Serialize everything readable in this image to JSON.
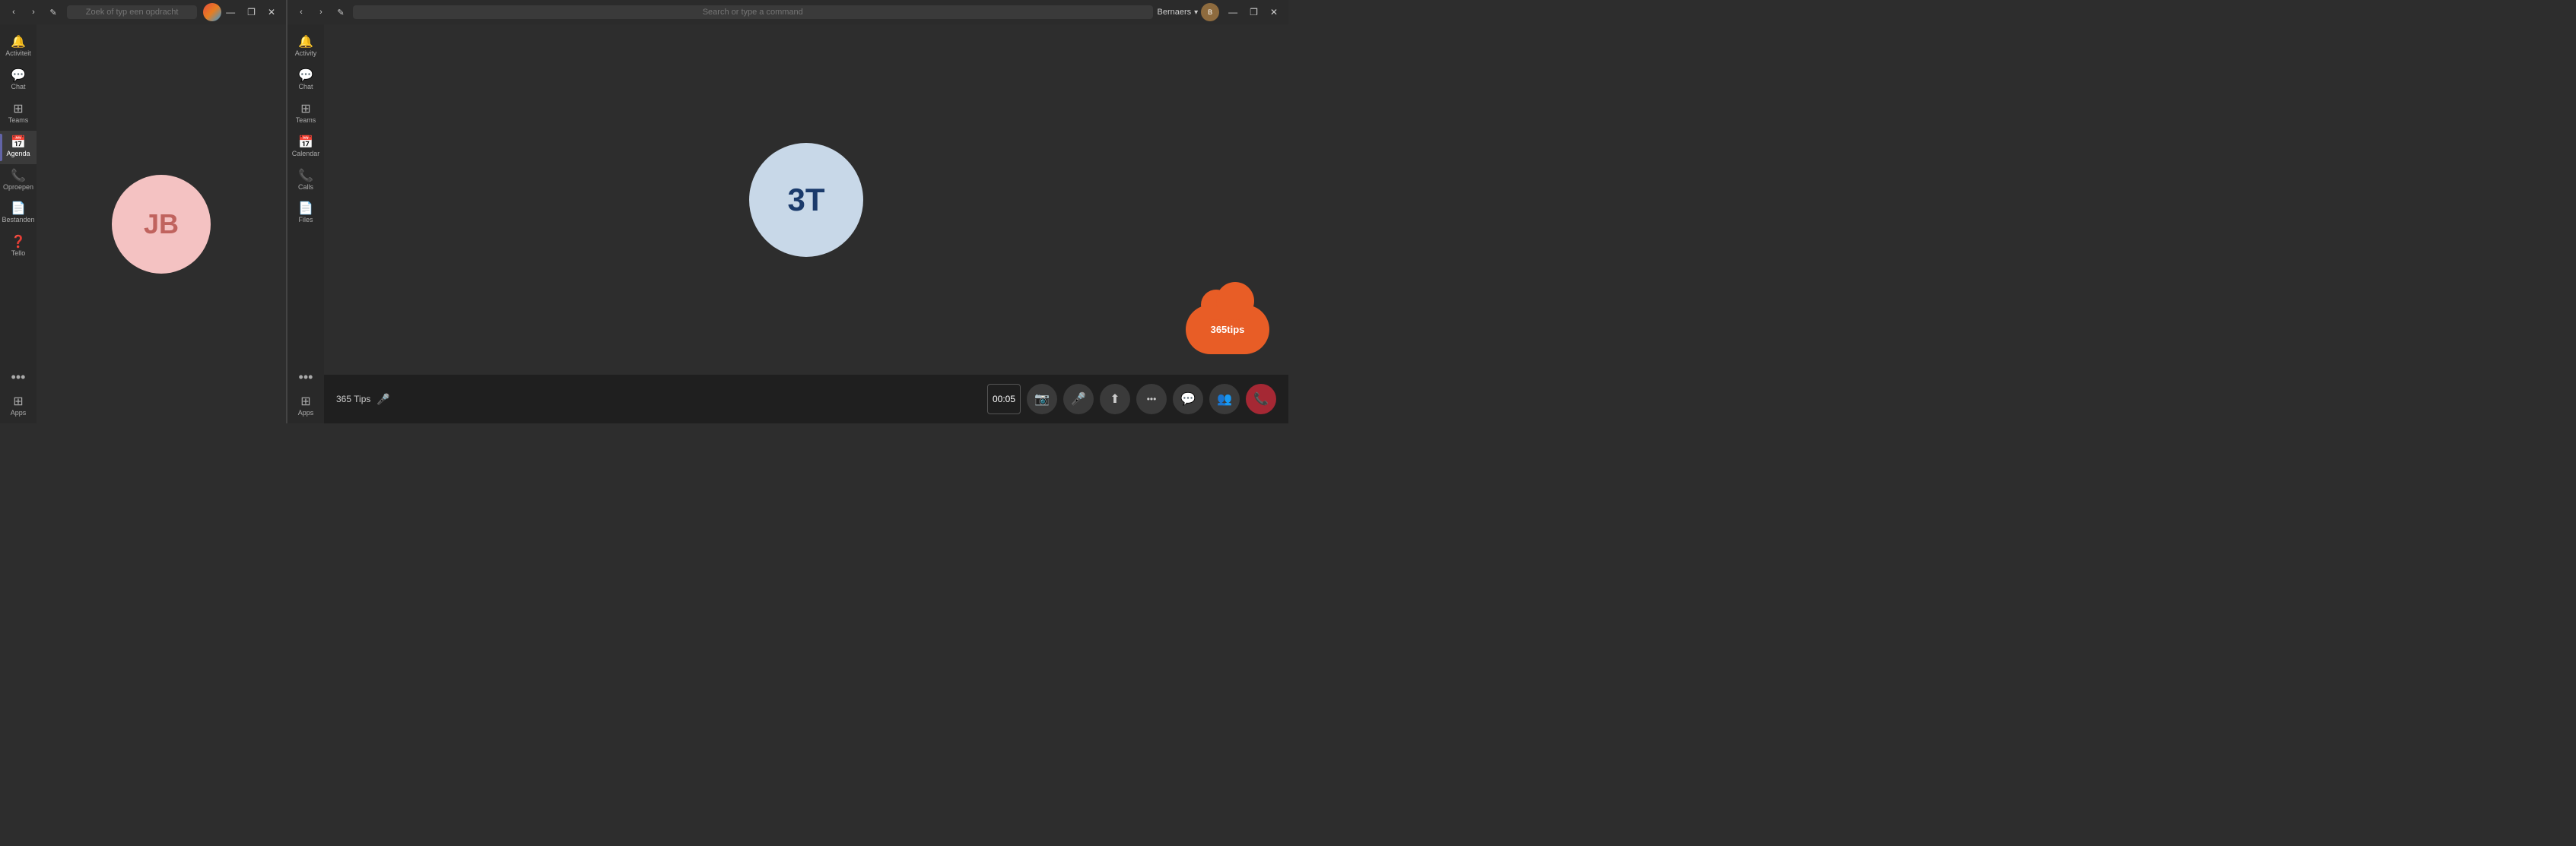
{
  "left_window": {
    "titlebar": {
      "search_placeholder": "Zoek of typ een opdracht",
      "back_btn": "‹",
      "forward_btn": "›",
      "edit_btn": "✎",
      "minimize_btn": "—",
      "maximize_btn": "❐",
      "close_btn": "✕"
    },
    "sidebar": {
      "items": [
        {
          "id": "activity",
          "label": "Activiteit",
          "icon": "🔔"
        },
        {
          "id": "chat",
          "label": "Chat",
          "icon": "💬"
        },
        {
          "id": "teams",
          "label": "Teams",
          "icon": "⊞"
        },
        {
          "id": "calendar",
          "label": "Agenda",
          "icon": "📅",
          "active": true
        },
        {
          "id": "calls",
          "label": "Oproepen",
          "icon": "📞"
        },
        {
          "id": "files",
          "label": "Bestanden",
          "icon": "📄"
        },
        {
          "id": "help",
          "label": "Tello",
          "icon": "❓"
        },
        {
          "id": "apps",
          "label": "Apps",
          "icon": "⊞"
        }
      ],
      "more_label": "..."
    },
    "avatar": {
      "initials": "JB",
      "bg_color": "#f4c2c2",
      "text_color": "#c0635e"
    }
  },
  "right_window": {
    "titlebar": {
      "search_placeholder": "Search or type a command",
      "back_btn": "‹",
      "forward_btn": "›",
      "edit_btn": "✎",
      "user_name": "Bernaers",
      "minimize_btn": "—",
      "maximize_btn": "❐",
      "close_btn": "✕"
    },
    "sidebar": {
      "items": [
        {
          "id": "activity",
          "label": "Activity",
          "icon": "🔔"
        },
        {
          "id": "chat",
          "label": "Chat",
          "icon": "💬"
        },
        {
          "id": "teams",
          "label": "Teams",
          "icon": "⊞"
        },
        {
          "id": "calendar",
          "label": "Calendar",
          "icon": "📅"
        },
        {
          "id": "calls",
          "label": "Calls",
          "icon": "📞"
        },
        {
          "id": "files",
          "label": "Files",
          "icon": "📄"
        },
        {
          "id": "apps",
          "label": "Apps",
          "icon": "⊞"
        }
      ],
      "more_label": "..."
    },
    "avatar": {
      "initials": "3T",
      "bg_color": "#c8d8e8",
      "text_color": "#1a3a6b"
    },
    "call": {
      "caller_name": "365 Tips",
      "timer": "00:05",
      "controls": [
        {
          "id": "video",
          "icon": "📷",
          "label": "Video"
        },
        {
          "id": "mute",
          "icon": "🎤",
          "label": "Mute"
        },
        {
          "id": "share",
          "icon": "⬆",
          "label": "Share"
        },
        {
          "id": "more",
          "icon": "•••",
          "label": "More"
        },
        {
          "id": "chat",
          "icon": "💬",
          "label": "Chat"
        },
        {
          "id": "participants",
          "icon": "👥",
          "label": "Participants"
        },
        {
          "id": "end",
          "icon": "📞",
          "label": "End"
        }
      ]
    },
    "tips_logo": {
      "text": "365tips",
      "icon": "☁"
    }
  }
}
